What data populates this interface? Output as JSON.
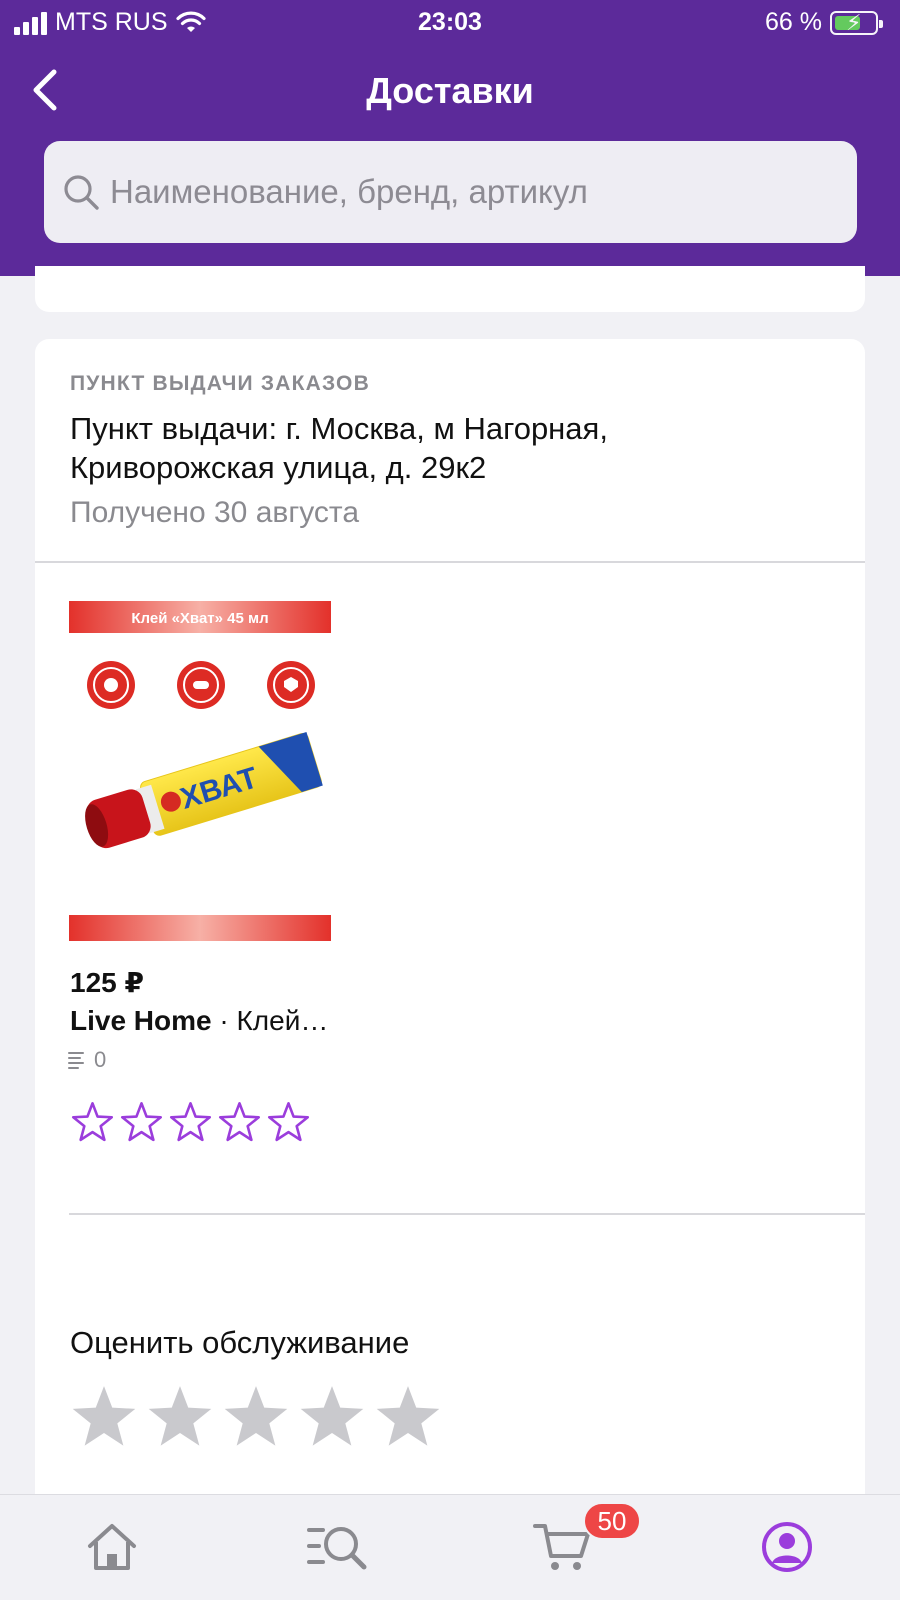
{
  "status_bar": {
    "carrier": "MTS RUS",
    "time": "23:03",
    "battery_percent": "66 %",
    "battery_level": 0.66
  },
  "header": {
    "back_icon": "chevron-left-icon",
    "title": "Доставки"
  },
  "search": {
    "icon": "search-icon",
    "placeholder": "Наименование, бренд, артикул"
  },
  "delivery": {
    "type_label": "ПУНКТ ВЫДАЧИ ЗАКАЗОВ",
    "address": "Пункт выдачи: г. Москва, м Нагорная, Криворожская улица, д. 29к2",
    "status": "Получено 30 августа",
    "product": {
      "image_banner_text": "Клей «Хват» 45 мл",
      "tube_brand_text": "ХВАТ",
      "price": "125 ₽",
      "brand": "Live Home",
      "name": " · Клей…",
      "reviews_count": "0",
      "rating": 0,
      "rating_max": 5
    },
    "service_rating": {
      "title": "Оценить обслуживание",
      "value": 0,
      "max": 5
    }
  },
  "bottom_nav": {
    "items": [
      {
        "icon": "home-icon"
      },
      {
        "icon": "catalog-search-icon"
      },
      {
        "icon": "cart-icon",
        "badge": "50"
      },
      {
        "icon": "profile-icon",
        "active": true
      }
    ]
  },
  "colors": {
    "brand_purple": "#5c2a9a",
    "accent_purple": "#9b3ddc",
    "badge_red": "#ee4646",
    "star_empty_gray": "#c9c9cd"
  }
}
